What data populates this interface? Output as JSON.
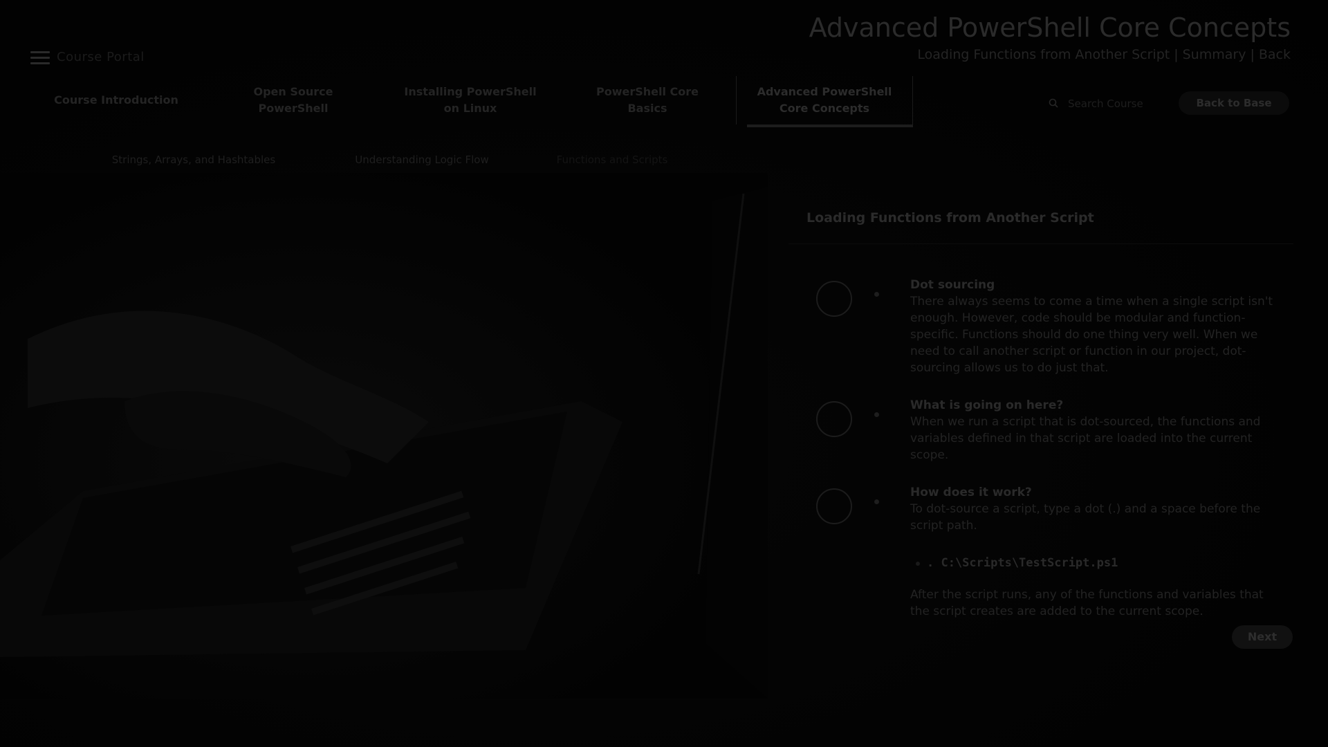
{
  "app": {
    "brand": "Course Portal"
  },
  "header": {
    "course_title": "Advanced PowerShell Core Concepts",
    "breadcrumb": [
      "Loading Functions from Another Script",
      "Summary",
      "Back"
    ]
  },
  "modules": [
    {
      "label": "Course Introduction",
      "active": false
    },
    {
      "label": "Open Source PowerShell",
      "active": false
    },
    {
      "label": "Installing PowerShell on Linux",
      "active": false
    },
    {
      "label": "PowerShell Core Basics",
      "active": false
    },
    {
      "label": "Advanced PowerShell Core Concepts",
      "active": true
    }
  ],
  "search": {
    "placeholder": "Search Course"
  },
  "back_button": {
    "label": "Back to Base"
  },
  "lesson_tabs": [
    "Strings, Arrays, and Hashtables",
    "Understanding Logic Flow",
    "Functions and Scripts"
  ],
  "panel": {
    "title": "Loading Functions from Another Script",
    "items": [
      {
        "icon": "code-icon",
        "heading": "Dot sourcing",
        "text": "There always seems to come a time when a single script isn't enough. However, code should be modular and function-specific. Functions should do one thing very well. When we need to call another script or function in our project, dot-sourcing allows us to do just that."
      },
      {
        "icon": "question-icon",
        "heading": "What is going on here?",
        "text": "When we run a script that is dot-sourced, the functions and variables defined in that script are loaded into the current scope."
      },
      {
        "icon": "gear-icon",
        "heading": "How does it work?",
        "text": "To dot-source a script, type a dot (.) and a space before the script path."
      }
    ],
    "code": ". C:\\Scripts\\TestScript.ps1",
    "after_text": "After the script runs, any of the functions and variables that the script creates are added to the current scope.",
    "next_label": "Next"
  },
  "colors": {
    "overlay": "#020202",
    "accent": "#0b0b0b"
  }
}
